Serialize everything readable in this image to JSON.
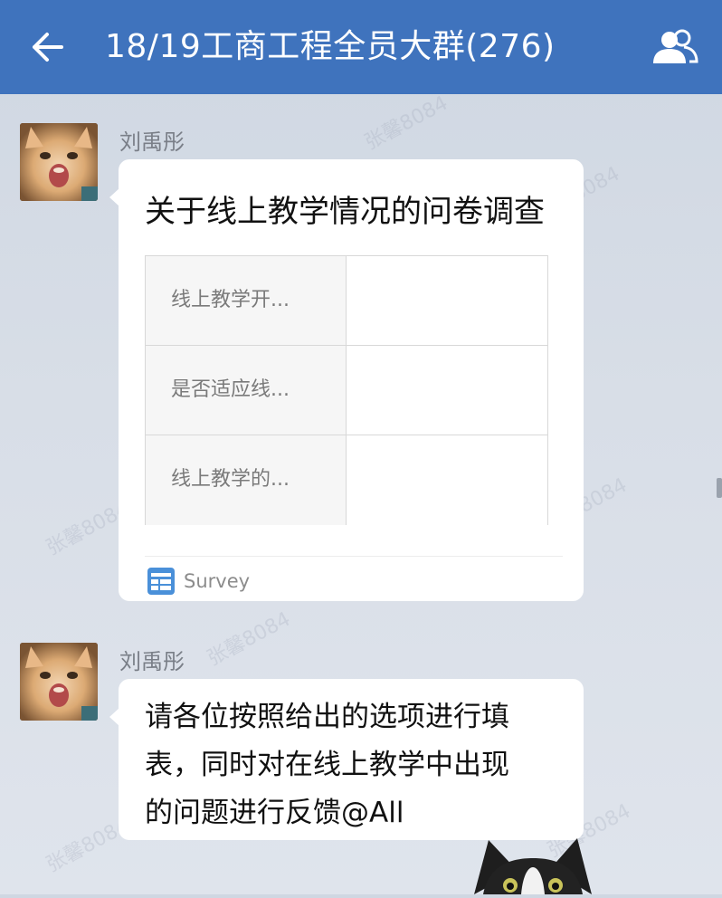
{
  "header": {
    "title": "18/19工商工程全员大群(276)",
    "back_icon": "arrow-left-icon",
    "members_icon": "group-members-icon",
    "bar_color": "#3f73bd"
  },
  "watermark": {
    "text": "张馨8084"
  },
  "messages": [
    {
      "sender": "刘禹彤",
      "type": "survey-card",
      "card": {
        "title": "关于线上教学情况的问卷调查",
        "rows": [
          {
            "question": "线上教学开...",
            "answer": ""
          },
          {
            "question": "是否适应线...",
            "answer": ""
          },
          {
            "question": "线上教学的...",
            "answer": ""
          }
        ],
        "footer_icon": "survey-table-icon",
        "footer_label": "Survey"
      }
    },
    {
      "sender": "刘禹彤",
      "type": "text",
      "lines": [
        "请各位按照给出的选项进行填",
        "表，同时对在线上教学中出现",
        "的问题进行反馈@All"
      ]
    }
  ]
}
